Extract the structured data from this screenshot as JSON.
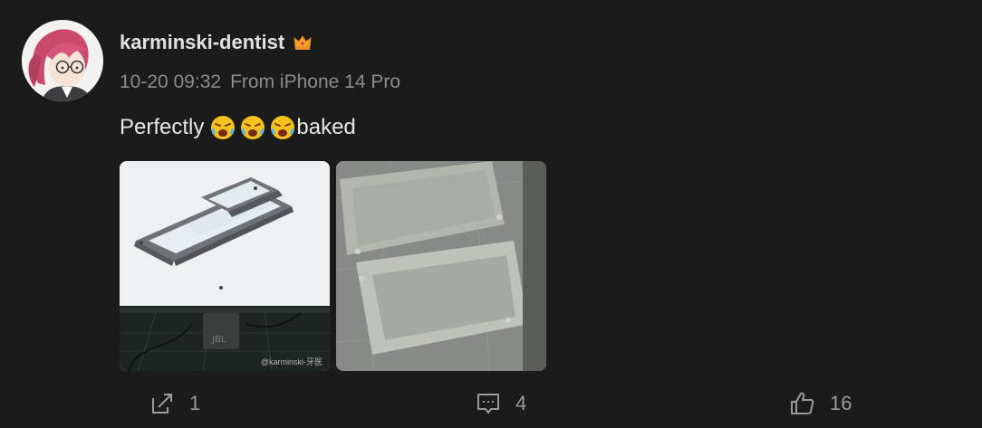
{
  "post": {
    "username": "karminski-dentist",
    "timestamp": "10-20 09:32",
    "source": "From iPhone 14 Pro",
    "text_before": "Perfectly",
    "text_after": "baked",
    "emojis": [
      "crying-face-emoji",
      "crying-face-emoji",
      "crying-face-emoji"
    ],
    "badge_icon": "crown-icon",
    "images": [
      {
        "name": "monitor-3d-print-preview-photo",
        "watermark": "@karminski-牙医"
      },
      {
        "name": "printed-frame-photo"
      }
    ]
  },
  "actions": {
    "share_count": "1",
    "comment_count": "4",
    "like_count": "16"
  },
  "colors": {
    "background": "#1b1b1b",
    "username": "#e2e2e2",
    "meta": "#8c8c8c",
    "action": "#9a9a9a"
  }
}
